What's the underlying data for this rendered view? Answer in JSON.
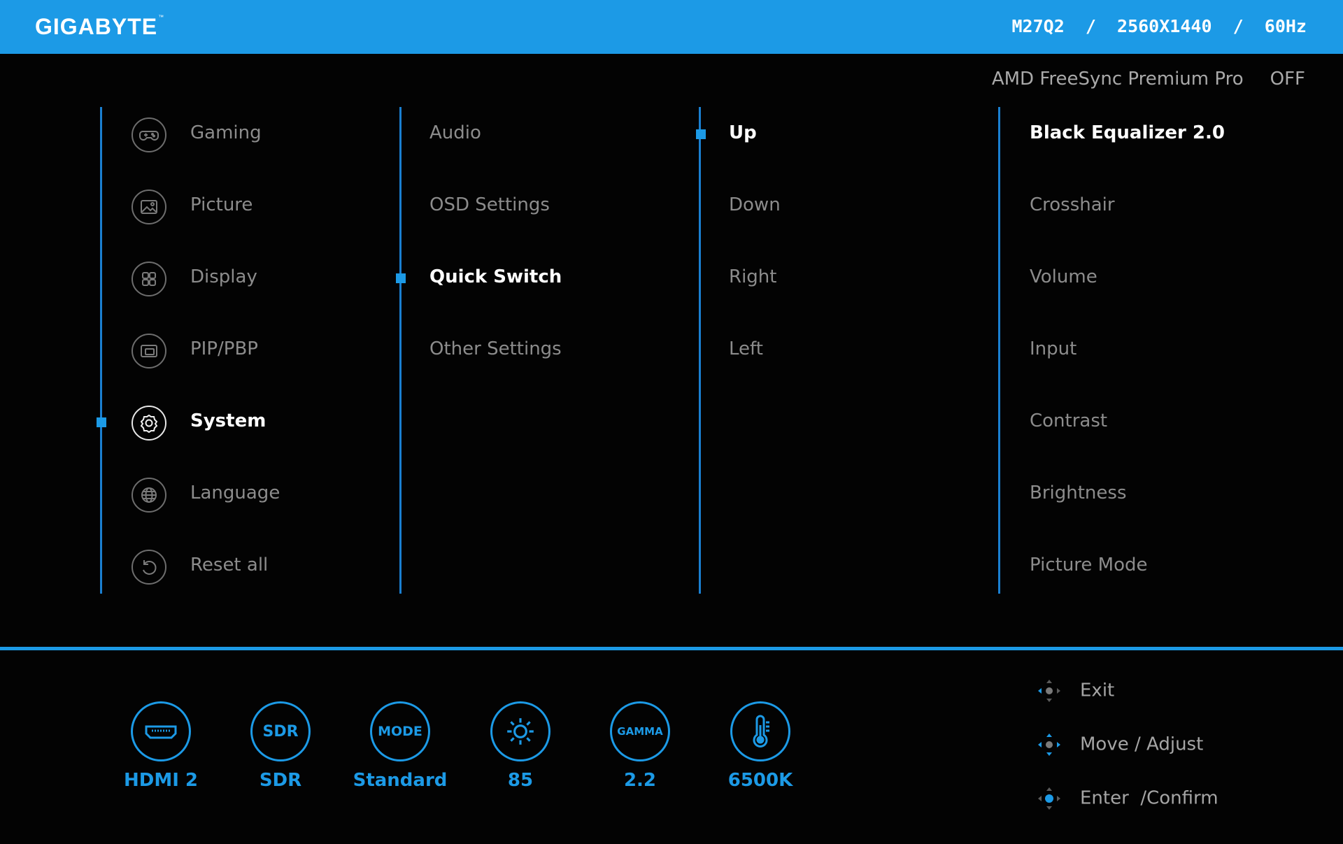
{
  "header": {
    "brand": "GIGABYTE",
    "trademark": "™",
    "model": "M27Q2",
    "resolution": "2560X1440",
    "refresh": "60Hz",
    "separator": "/"
  },
  "freesync": {
    "label": "AMD FreeSync Premium Pro",
    "value": "OFF"
  },
  "main_menu": [
    {
      "label": "Gaming",
      "icon": "gamepad-icon"
    },
    {
      "label": "Picture",
      "icon": "picture-icon"
    },
    {
      "label": "Display",
      "icon": "display-grid-icon"
    },
    {
      "label": "PIP/PBP",
      "icon": "pip-icon"
    },
    {
      "label": "System",
      "icon": "gear-icon",
      "selected": true
    },
    {
      "label": "Language",
      "icon": "globe-icon"
    },
    {
      "label": "Reset all",
      "icon": "reset-icon"
    }
  ],
  "system_menu": [
    {
      "label": "Audio"
    },
    {
      "label": "OSD Settings"
    },
    {
      "label": "Quick Switch",
      "selected": true
    },
    {
      "label": "Other Settings"
    }
  ],
  "quick_switch_menu": [
    {
      "label": "Up",
      "selected": true
    },
    {
      "label": "Down"
    },
    {
      "label": "Right"
    },
    {
      "label": "Left"
    }
  ],
  "function_menu": [
    {
      "label": "Black Equalizer 2.0",
      "selected": true
    },
    {
      "label": "Crosshair"
    },
    {
      "label": "Volume"
    },
    {
      "label": "Input"
    },
    {
      "label": "Contrast"
    },
    {
      "label": "Brightness"
    },
    {
      "label": "Picture Mode"
    }
  ],
  "status_bar": [
    {
      "icon": "hdmi-icon",
      "icon_text": "",
      "value": "HDMI 2"
    },
    {
      "icon": "sdr-icon",
      "icon_text": "SDR",
      "value": "SDR"
    },
    {
      "icon": "mode-icon",
      "icon_text": "MODE",
      "value": "Standard"
    },
    {
      "icon": "brightness-icon",
      "icon_text": "",
      "value": "85"
    },
    {
      "icon": "gamma-icon",
      "icon_text": "GAMMA",
      "value": "2.2"
    },
    {
      "icon": "thermometer-icon",
      "icon_text": "",
      "value": "6500K"
    }
  ],
  "hints": [
    {
      "icon": "nav-left-icon",
      "label": "Exit"
    },
    {
      "icon": "nav-all-icon",
      "label": "Move / Adjust"
    },
    {
      "icon": "nav-center-icon",
      "label": "Enter  /Confirm"
    }
  ],
  "colors": {
    "accent": "#1c9ae6",
    "header": "#1c9ae6",
    "background": "#030303"
  }
}
